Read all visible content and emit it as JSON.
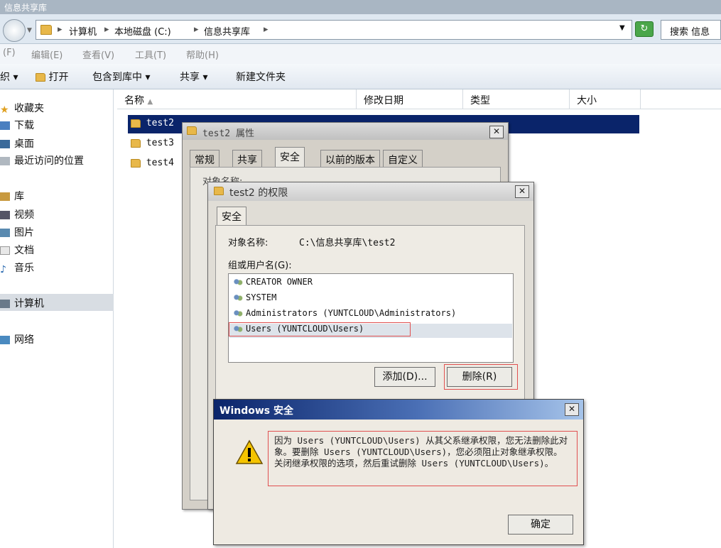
{
  "explorer": {
    "title": "信息共享库",
    "breadcrumb": [
      "计算机",
      "本地磁盘 (C:)",
      "信息共享库"
    ],
    "search_placeholder": "搜索 信息",
    "menu": [
      "(F)",
      "编辑(E)",
      "查看(V)",
      "工具(T)",
      "帮助(H)"
    ],
    "toolbar": [
      "织",
      "打开",
      "包含到库中",
      "共享",
      "新建文件夹"
    ],
    "sidebar": {
      "favorites": "收藏夹",
      "downloads": "下载",
      "desktop": "桌面",
      "recent": "最近访问的位置",
      "libraries": "库",
      "videos": "视频",
      "pictures": "图片",
      "documents": "文档",
      "music": "音乐",
      "computer": "计算机",
      "network": "网络"
    },
    "columns": [
      "名称",
      "修改日期",
      "类型",
      "大小"
    ],
    "files": [
      "test2",
      "test3",
      "test4"
    ]
  },
  "properties": {
    "title": "test2 属性",
    "tabs": [
      "常规",
      "共享",
      "安全",
      "以前的版本",
      "自定义"
    ],
    "object_label_partial": "对象名称:"
  },
  "permissions": {
    "title": "test2 的权限",
    "tab": "安全",
    "object_label": "对象名称:",
    "object_value": "C:\\信息共享库\\test2",
    "group_label": "组或用户名(G):",
    "users": [
      "CREATOR OWNER",
      "SYSTEM",
      "Administrators (YUNTCLOUD\\Administrators)",
      "Users (YUNTCLOUD\\Users)"
    ],
    "add_button": "添加(D)...",
    "remove_button": "删除(R)"
  },
  "security_dialog": {
    "title": "Windows 安全",
    "message": "因为 Users (YUNTCLOUD\\Users) 从其父系继承权限，您无法删除此对象。要删除 Users (YUNTCLOUD\\Users)，您必须阻止对象继承权限。关闭继承权限的选项，然后重试删除 Users (YUNTCLOUD\\Users)。",
    "ok_button": "确定"
  },
  "colors": {
    "selection": "#0a246a",
    "highlight_box": "#e05050",
    "dialog_title_start": "#0a246a",
    "dialog_title_end": "#a6c4ea"
  }
}
